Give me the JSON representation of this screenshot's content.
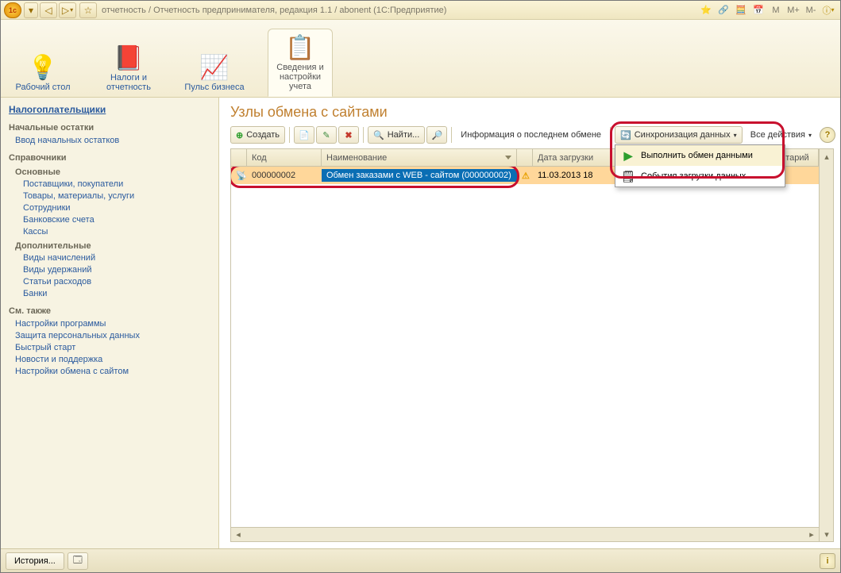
{
  "titlebar": {
    "text": "отчетность / Отчетность предпринимателя, редакция 1.1 / abonent (1С:Предприятие)"
  },
  "title_right": {
    "m": "M",
    "mplus": "M+",
    "mminus": "M-"
  },
  "sections": [
    {
      "label": "Рабочий стол",
      "active": false
    },
    {
      "label": "Налоги и отчетность",
      "active": false
    },
    {
      "label": "Пульс бизнеса",
      "active": false
    },
    {
      "label": "Сведения и настройки учета",
      "active": true
    }
  ],
  "sidebar": {
    "top": "Налогоплательщики",
    "groups": [
      {
        "header": "Начальные остатки",
        "links": [
          "Ввод начальных остатков"
        ]
      },
      {
        "header": "Справочники",
        "sub": [
          {
            "sub": "Основные",
            "links": [
              "Поставщики, покупатели",
              "Товары, материалы, услуги",
              "Сотрудники",
              "Банковские счета",
              "Кассы"
            ]
          },
          {
            "sub": "Дополнительные",
            "links": [
              "Виды начислений",
              "Виды удержаний",
              "Статьи расходов",
              "Банки"
            ]
          }
        ]
      },
      {
        "header": "См. также",
        "links": [
          "Настройки программы",
          "Защита персональных данных",
          "Быстрый старт",
          "Новости и поддержка",
          "Настройки обмена с сайтом"
        ]
      }
    ]
  },
  "page": {
    "title": "Узлы обмена с сайтами"
  },
  "toolbar": {
    "create": "Создать",
    "find": "Найти...",
    "last_exchange": "Информация о последнем обмене",
    "sync": "Синхронизация данных",
    "all_actions": "Все действия"
  },
  "dropdown": {
    "run": "Выполнить обмен данными",
    "events": "События загрузки данных"
  },
  "grid": {
    "cols": {
      "code": "Код",
      "name": "Наименование",
      "date": "Дата загрузки",
      "comment": "ентарий"
    },
    "row": {
      "code": "000000002",
      "name": "Обмен заказами с WEB - сайтом (000000002)",
      "date": "11.03.2013 18"
    }
  },
  "statusbar": {
    "history": "История..."
  }
}
